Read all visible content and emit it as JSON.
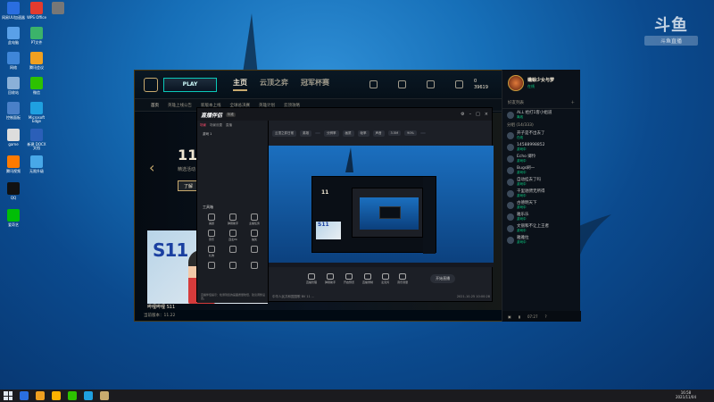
{
  "watermark": {
    "logo": "斗鱼",
    "sub": "斗鱼直播"
  },
  "desktop_icons": [
    {
      "label": "网易UU加速器",
      "color": "#2a6ee0"
    },
    {
      "label": "WPS Office",
      "color": "#e23b2e"
    },
    {
      "label": "",
      "color": "#777"
    },
    {
      "label": "此电脑",
      "color": "#5aa0e8"
    },
    {
      "label": "PT文件",
      "color": "#3bb36a"
    },
    {
      "label": "网络",
      "color": "#3f86d8"
    },
    {
      "label": "腾讯会议",
      "color": "#f0a020"
    },
    {
      "label": "回收站",
      "color": "#8ab0d8"
    },
    {
      "label": "微信",
      "color": "#2dc100"
    },
    {
      "label": "控制面板",
      "color": "#4a80c8"
    },
    {
      "label": "Microsoft Edge",
      "color": "#1fa0e0"
    },
    {
      "label": "game",
      "color": "#ddd"
    },
    {
      "label": "新建 DOCX 文档",
      "color": "#2b5fb8"
    },
    {
      "label": "腾讯视频",
      "color": "#ff7a00"
    },
    {
      "label": "无限升级",
      "color": "#48a8e8"
    },
    {
      "label": "QQ",
      "color": "#111"
    },
    {
      "label": "爱奇艺",
      "color": "#00be06"
    }
  ],
  "lol": {
    "play": "PLAY",
    "nav": [
      "主页",
      "云顶之弈",
      "冠军杯赛"
    ],
    "top_icons": [
      "",
      "",
      "",
      ""
    ],
    "coins_be": "0",
    "coins_rp": "39619",
    "subnav": [
      "首页",
      "英雄上线公告",
      "新版本上线",
      "全球总决赛",
      "英雄计划",
      "云顶攻略",
      "",
      "",
      "",
      ""
    ],
    "promo_title": "11",
    "promo_sub": "精选活动",
    "promo_btn": "了解",
    "s11_text": "S11",
    "s11_caption": "哔哩哔哩 S11",
    "status": "当前版本：11.22"
  },
  "social": {
    "name": "蟾蜍少女与萝",
    "status": "在线",
    "tools_label": "好友列表",
    "friends_top": [
      {
        "name": "ALL 给打1客小姐道",
        "status": "离线"
      }
    ],
    "group": "分组 (14/333)",
    "friends": [
      {
        "name": "开子是不出去了",
        "status": "在线"
      },
      {
        "name": "14588998852",
        "status": "游戏中"
      },
      {
        "name": "Echo 卿怜",
        "status": "游戏中"
      },
      {
        "name": "Bugs刷一",
        "status": "游戏中"
      },
      {
        "name": "自动挂去了吗",
        "status": "游戏中"
      },
      {
        "name": "千里驰骋无所得",
        "status": "游戏中"
      },
      {
        "name": "古德明天下",
        "status": "游戏中"
      },
      {
        "name": "雅乐乐",
        "status": "游戏中"
      },
      {
        "name": "文丽和不让上王者",
        "status": "游戏中"
      },
      {
        "name": "雅雅拉",
        "status": "游戏中"
      }
    ],
    "foot": "07:27"
  },
  "obs": {
    "title": "直播伴侣",
    "tag": "标准",
    "tabs": [
      "场景",
      "场景设置",
      "直播"
    ],
    "scene": "游戏 1",
    "tools_label": "工具箱",
    "tools": [
      "美颜",
      "弹幕助手",
      "主播任务",
      "音乐",
      "连麦PK",
      "抽奖",
      "礼物",
      "",
      "",
      "",
      "",
      ""
    ],
    "notice": "直播伴侣提示：检测到您的画面质量较低，建议调整设置。",
    "toolbar": [
      "云顶之弈日常",
      "英雄",
      "",
      "分辨率",
      "画质",
      "帧率",
      "声音",
      "3.5M",
      "90%",
      ""
    ],
    "preview_11": "11",
    "preview_s11": "S11",
    "controls": [
      "直播管理",
      "弹幕助手",
      "开启预览",
      "直播录制",
      "麦克风",
      "音乐音量"
    ],
    "start": "开始直播",
    "status_left": "中华人民共和国国歌 BV 11 ...",
    "status_date": "2021-10-25  10:00:28"
  },
  "taskbar": {
    "apps": [
      "#2a6ee0",
      "#f0a020",
      "#ffb200",
      "#2dc100",
      "#1fa0e0",
      "#c8aa6e"
    ],
    "time": "16:58",
    "date": "2021/11/04"
  }
}
